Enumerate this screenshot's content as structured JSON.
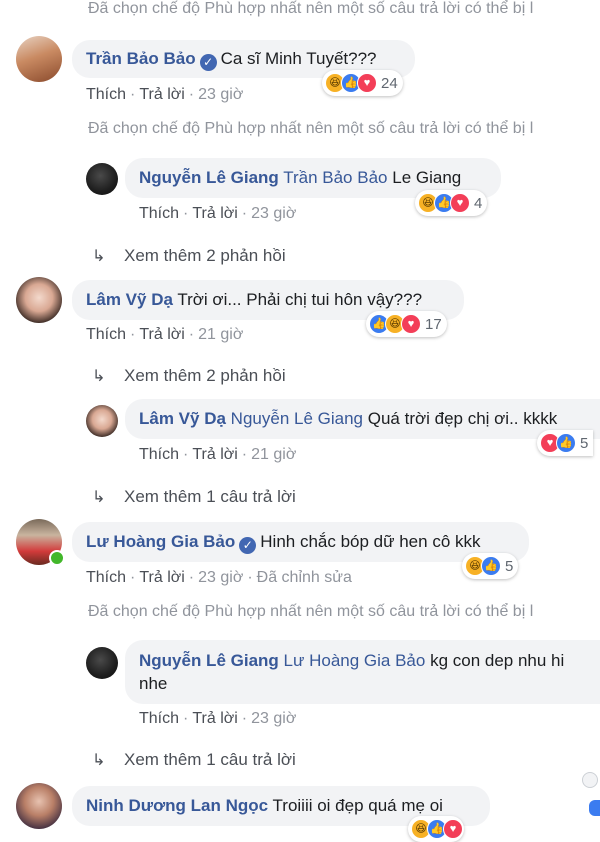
{
  "filter_notice": "Đã chọn chế độ Phù hợp nhất nên một số câu trả lời có thể bị l",
  "actions": {
    "like": "Thích",
    "reply": "Trả lời",
    "edited": "Đã chỉnh sửa"
  },
  "comments": [
    {
      "name": "Trần Bảo Bảo",
      "verified": true,
      "text": "Ca sĩ Minh Tuyết???",
      "reactions": [
        "haha",
        "like",
        "love"
      ],
      "count": "24",
      "time": "23 giờ"
    },
    {
      "name": "Nguyễn Lê Giang",
      "mention": "Trần Bảo Bảo",
      "text": "Le Giang",
      "reactions": [
        "haha",
        "like",
        "love"
      ],
      "count": "4",
      "time": "23 giờ"
    },
    {
      "more": "Xem thêm 2 phản hồi"
    },
    {
      "name": "Lâm Vỹ Dạ",
      "text": "Trời ơi... Phải chị tui hôn vậy???",
      "reactions": [
        "like",
        "haha",
        "love"
      ],
      "count": "17",
      "time": "21 giờ"
    },
    {
      "more": "Xem thêm 2 phản hồi"
    },
    {
      "name": "Lâm Vỹ Dạ",
      "mention": "Nguyễn Lê Giang",
      "text": "Quá trời đẹp chị ơi.. kkkk",
      "reactions": [
        "love",
        "like"
      ],
      "count": "5",
      "time": "21 giờ"
    },
    {
      "more": "Xem thêm 1 câu trả lời"
    },
    {
      "name": "Lư Hoàng Gia Bảo",
      "verified": true,
      "text": "Hinh chắc bóp dữ hen cô kkk",
      "reactions": [
        "haha",
        "like"
      ],
      "count": "5",
      "time": "23 giờ"
    },
    {
      "name": "Nguyễn Lê Giang",
      "mention": "Lư Hoàng Gia Bảo",
      "text": "kg con dep nhu hi",
      "text2": "nhe",
      "time": "23 giờ"
    },
    {
      "more": "Xem thêm 1 câu trả lời"
    },
    {
      "name": "Ninh Dương Lan Ngọc",
      "text": "Troiiii oi đẹp quá mẹ oi"
    }
  ],
  "colors": {
    "name": "#385898",
    "bubble": "#f2f3f5",
    "muted": "#90949c",
    "like": "#3b7cf0",
    "love": "#f33e58",
    "haha": "#f7b125"
  }
}
